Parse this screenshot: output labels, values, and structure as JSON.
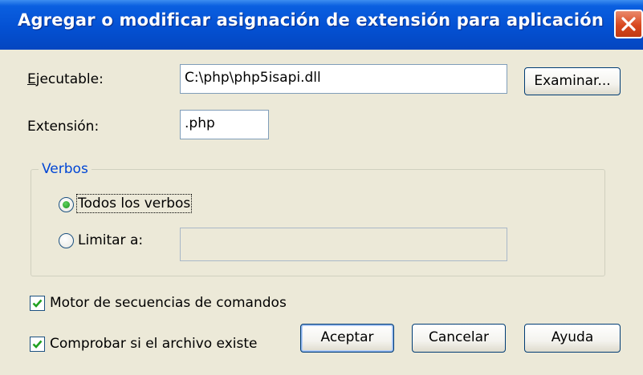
{
  "window": {
    "title": "Agregar o modificar asignación de extensión para aplicación",
    "close_icon": "close-icon"
  },
  "form": {
    "executable_label": "Ejecutable:",
    "executable_value": "C:\\php\\php5isapi.dll",
    "browse_button": "Examinar...",
    "extension_label": "Extensión:",
    "extension_value": ".php"
  },
  "verbs": {
    "group_label": "Verbos",
    "all_verbs_label": "Todos los verbos",
    "all_verbs_selected": true,
    "limit_to_label": "Limitar a:",
    "limit_to_selected": false,
    "limit_to_value": ""
  },
  "options": {
    "script_engine_label": "Motor de secuencias de comandos",
    "script_engine_checked": true,
    "verify_file_label": "Comprobar si el archivo existe",
    "verify_file_checked": true
  },
  "buttons": {
    "ok": "Aceptar",
    "cancel": "Cancelar",
    "help": "Ayuda"
  },
  "colors": {
    "titlebar": "#0451d3",
    "dialog_background": "#ece9d8",
    "group_label": "#0046d5",
    "close_button": "#d9481f",
    "radio_dot": "#1e8f1e",
    "check_mark": "#21a121"
  }
}
